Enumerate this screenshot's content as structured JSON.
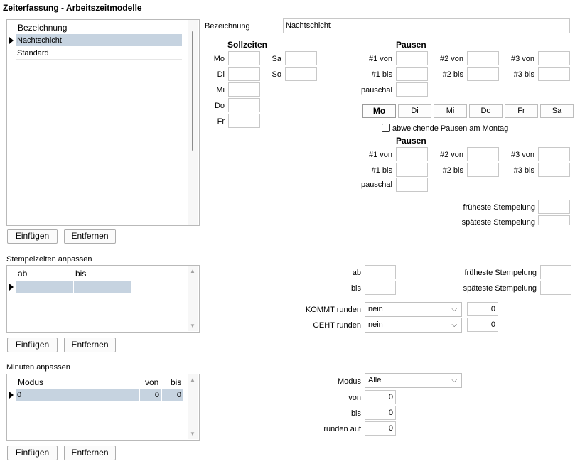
{
  "window_title": "Zeiterfassung - Arbeitszeitmodelle",
  "models": {
    "header": "Bezeichnung",
    "rows": [
      "Nachtschicht",
      "Standard"
    ],
    "selected": 0,
    "add_label": "Einfügen",
    "remove_label": "Entfernen"
  },
  "detail": {
    "bezeichnung_label": "Bezeichnung",
    "bezeichnung_value": "Nachtschicht",
    "sollzeiten_title": "Sollzeiten",
    "days_left": [
      "Mo",
      "Di",
      "Mi",
      "Do",
      "Fr"
    ],
    "days_right": [
      "Sa",
      "So"
    ],
    "pausen_title": "Pausen",
    "pause_labels": {
      "v1": "#1 von",
      "v2": "#2 von",
      "v3": "#3 von",
      "b1": "#1 bis",
      "b2": "#2 bis",
      "b3": "#3 bis",
      "pauschal": "pauschal"
    },
    "day_tabs": [
      "Mo",
      "Di",
      "Mi",
      "Do",
      "Fr",
      "Sa"
    ],
    "active_tab": 0,
    "abweichend_label": "abweichende Pausen am Montag",
    "abweichend_checked": false,
    "fruehe_label": "früheste Stempelung",
    "spaete_label": "späteste Stempelung"
  },
  "stempel": {
    "section_label": "Stempelzeiten anpassen",
    "headers": [
      "ab",
      "bis"
    ],
    "add_label": "Einfügen",
    "remove_label": "Entfernen",
    "ab_label": "ab",
    "bis_label": "bis",
    "fruehe_label": "früheste Stempelung",
    "spaete_label": "späteste Stempelung",
    "kommt_label": "KOMMT runden",
    "kommt_value": "nein",
    "kommt_num": "0",
    "geht_label": "GEHT runden",
    "geht_value": "nein",
    "geht_num": "0"
  },
  "minuten": {
    "section_label": "Minuten anpassen",
    "headers": [
      "Modus",
      "von",
      "bis"
    ],
    "row": [
      "0",
      "0",
      "0"
    ],
    "add_label": "Einfügen",
    "remove_label": "Entfernen",
    "modus_label": "Modus",
    "modus_value": "Alle",
    "von_label": "von",
    "von_value": "0",
    "bis_label": "bis",
    "bis_value": "0",
    "runden_label": "runden auf",
    "runden_value": "0"
  }
}
